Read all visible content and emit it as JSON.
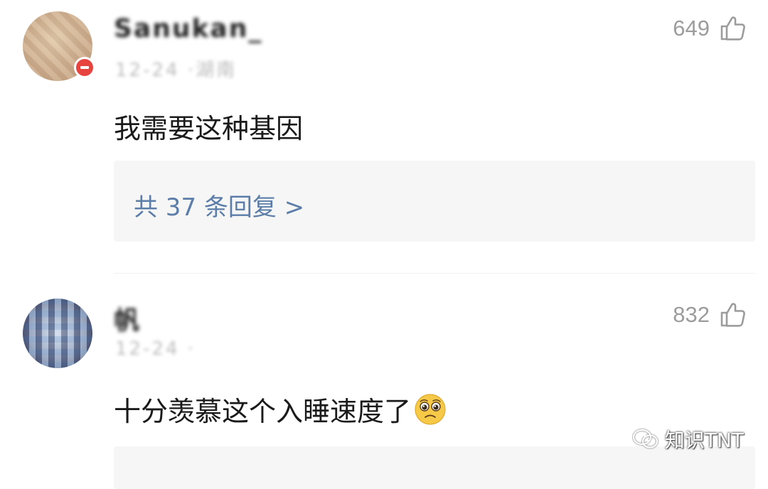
{
  "comments": [
    {
      "username": "Sanukan_",
      "time": "12-24 ·湖南",
      "likes": "649",
      "content": "我需要这种基因",
      "replies_label": "共 37 条回复 >"
    },
    {
      "username": "帆",
      "time": "12-24 ·",
      "likes": "832",
      "content": "十分羡慕这个入睡速度了"
    }
  ],
  "watermark": {
    "text": "知识TNT"
  },
  "icons": {
    "like": "thumbs-up-icon",
    "emoji": "pleading-face-emoji",
    "watermark": "wechat-icon"
  },
  "colors": {
    "reply_link": "#5b7da8",
    "like_gray": "#9c9c9c",
    "badge_red": "#e8443f"
  }
}
